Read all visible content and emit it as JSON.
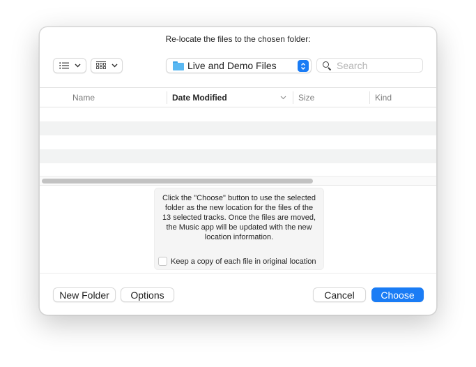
{
  "dialog": {
    "prompt": "Re-locate the files to the chosen folder:"
  },
  "toolbar": {
    "view_list_icon": "list-view-icon",
    "view_grid_icon": "grid-view-icon",
    "chevron": "⌄",
    "location": "Live and Demo Files",
    "search_placeholder": "Search",
    "search_value": ""
  },
  "table": {
    "columns": [
      {
        "label": "Name",
        "sorted": false
      },
      {
        "label": "Date Modified",
        "sorted": true,
        "sort_direction": "descending"
      },
      {
        "label": "Size",
        "sorted": false
      },
      {
        "label": "Kind",
        "sorted": false
      }
    ],
    "rows": []
  },
  "info": {
    "message": "Click the \"Choose\" button to use the selected folder as the new location for the files of the 13 selected tracks. Once the files are moved, the Music app will be updated with the new location information.",
    "keep_copy_label": "Keep a copy of each file in original location",
    "keep_copy_checked": false
  },
  "buttons": {
    "new_folder": "New Folder",
    "options": "Options",
    "cancel": "Cancel",
    "choose": "Choose"
  },
  "colors": {
    "accent": "#1a7cf5",
    "folder": "#5ab8f2"
  }
}
